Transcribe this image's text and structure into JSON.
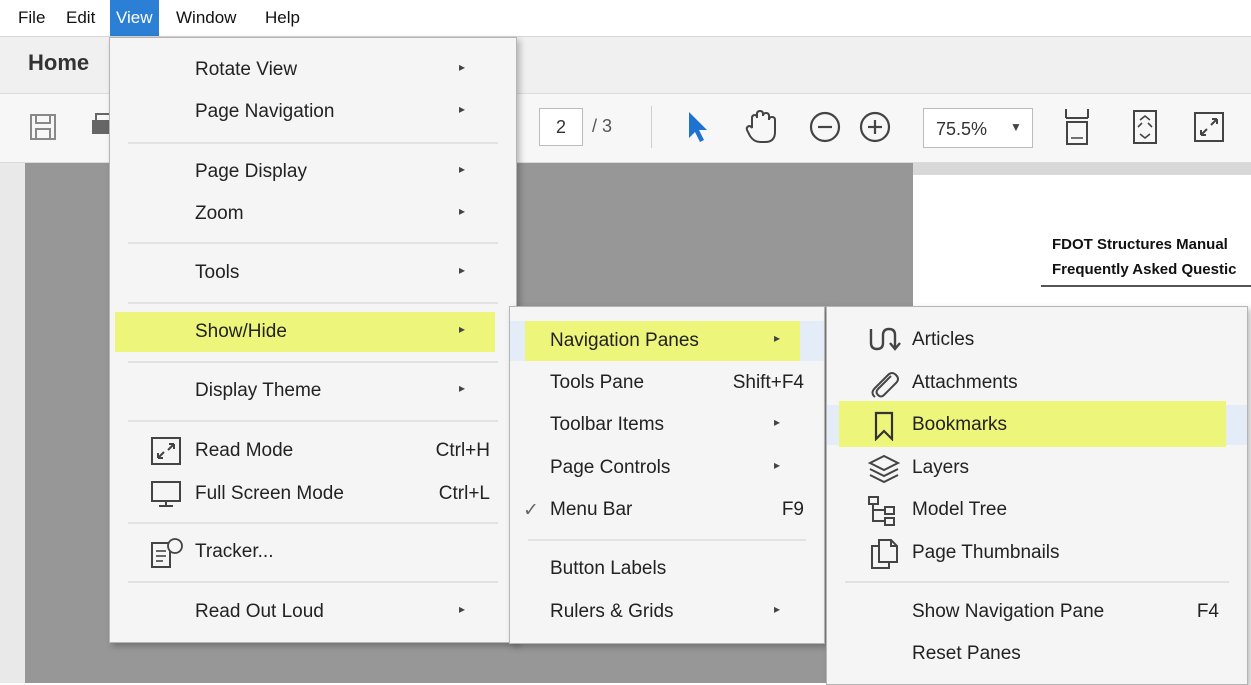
{
  "menubar": {
    "items": [
      "File",
      "Edit",
      "View",
      "Window",
      "Help"
    ],
    "open_item": "View"
  },
  "tabs": {
    "home": "Home"
  },
  "toolbar": {
    "current_page": "2",
    "total_pages": "/ 3",
    "zoom": "75.5%",
    "icons": [
      "save-icon",
      "print-icon",
      "select-cursor-icon",
      "hand-tool-icon",
      "zoom-out-icon",
      "zoom-in-icon",
      "fit-page-icon",
      "fit-width-icon",
      "full-screen-icon"
    ]
  },
  "document": {
    "line1": "FDOT Structures Manual",
    "line2": "Frequently Asked Questic"
  },
  "view_menu": {
    "items": [
      {
        "label": "Rotate View",
        "arrow": "▸"
      },
      {
        "label": "Page Navigation",
        "arrow": "▸"
      },
      {
        "label": "Page Display",
        "arrow": "▸"
      },
      {
        "label": "Zoom",
        "arrow": "▸"
      },
      {
        "label": "Tools",
        "arrow": "▸"
      },
      {
        "label": "Show/Hide",
        "arrow": "▸"
      },
      {
        "label": "Display Theme",
        "arrow": "▸"
      },
      {
        "label": "Read Mode",
        "shortcut": "Ctrl+H",
        "icon": "read-mode-icon"
      },
      {
        "label": "Full Screen Mode",
        "shortcut": "Ctrl+L",
        "icon": "monitor-icon"
      },
      {
        "label": "Tracker...",
        "icon": "tracker-icon"
      },
      {
        "label": "Read Out Loud",
        "arrow": "▸"
      }
    ]
  },
  "showhide_menu": {
    "items": [
      {
        "label": "Navigation Panes",
        "arrow": "▸"
      },
      {
        "label": "Tools Pane",
        "shortcut": "Shift+F4"
      },
      {
        "label": "Toolbar Items",
        "arrow": "▸"
      },
      {
        "label": "Page Controls",
        "arrow": "▸"
      },
      {
        "label": "Menu Bar",
        "shortcut": "F9",
        "check": "✓"
      },
      {
        "label": "Button Labels"
      },
      {
        "label": "Rulers & Grids",
        "arrow": "▸"
      }
    ]
  },
  "navpanes_menu": {
    "items": [
      {
        "label": "Articles",
        "icon": "articles-icon"
      },
      {
        "label": "Attachments",
        "icon": "paperclip-icon"
      },
      {
        "label": "Bookmarks",
        "icon": "bookmark-icon"
      },
      {
        "label": "Layers",
        "icon": "layers-icon"
      },
      {
        "label": "Model Tree",
        "icon": "model-tree-icon"
      },
      {
        "label": "Page Thumbnails",
        "icon": "page-thumbnails-icon"
      },
      {
        "label": "Show Navigation Pane",
        "shortcut": "F4"
      },
      {
        "label": "Reset Panes"
      }
    ]
  },
  "colors": {
    "highlight": "#eef57b",
    "menu_active": "#2b7fd4",
    "select_cursor": "#1e73d2"
  }
}
